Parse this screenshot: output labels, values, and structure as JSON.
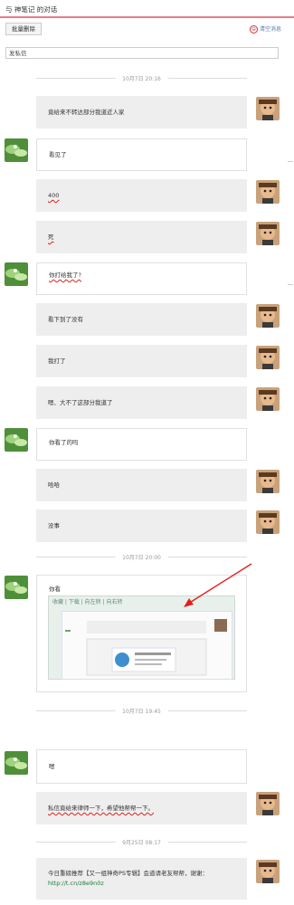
{
  "header": {
    "title": "与  神笔记  的对话"
  },
  "toolbar": {
    "batch_delete_label": "批量删除",
    "clear_messages_label": "清空消息"
  },
  "compose": {
    "placeholder": "发私信"
  },
  "conversation": {
    "time_dividers": [
      "10月7日 20:16",
      "10月7日 20:00",
      "10月7日 19:45",
      "9月25日 08:17"
    ],
    "messages": [
      {
        "sender": "me",
        "text": "竟给来不转达部分我道近人家"
      },
      {
        "sender": "them",
        "text": "看见了"
      },
      {
        "sender": "me",
        "text": "400"
      },
      {
        "sender": "me",
        "text": "死"
      },
      {
        "sender": "them",
        "text": "你打给我了?"
      },
      {
        "sender": "me",
        "text": "看下到了没有"
      },
      {
        "sender": "me",
        "text": "我打了"
      },
      {
        "sender": "me",
        "text": "嗯、大不了这部分我道了"
      },
      {
        "sender": "them",
        "text": "你看了的吗"
      },
      {
        "sender": "me",
        "text": "哈哈"
      },
      {
        "sender": "me",
        "text": "没事"
      },
      {
        "sender": "them",
        "text": "你看"
      },
      {
        "sender": "them",
        "text": "嗯"
      },
      {
        "sender": "me",
        "text": "私信竟给来律师一下，希望他帮帮一下。"
      },
      {
        "sender": "me",
        "text": "今日重磅推荐【又一组神奇PS专辑】会道请老友帮帮，谢谢：",
        "link": "http://t.cn/z8e9n0z"
      }
    ],
    "screenshot_toolbar": "收藏 | 下载 | 向左转 | 向右转"
  }
}
